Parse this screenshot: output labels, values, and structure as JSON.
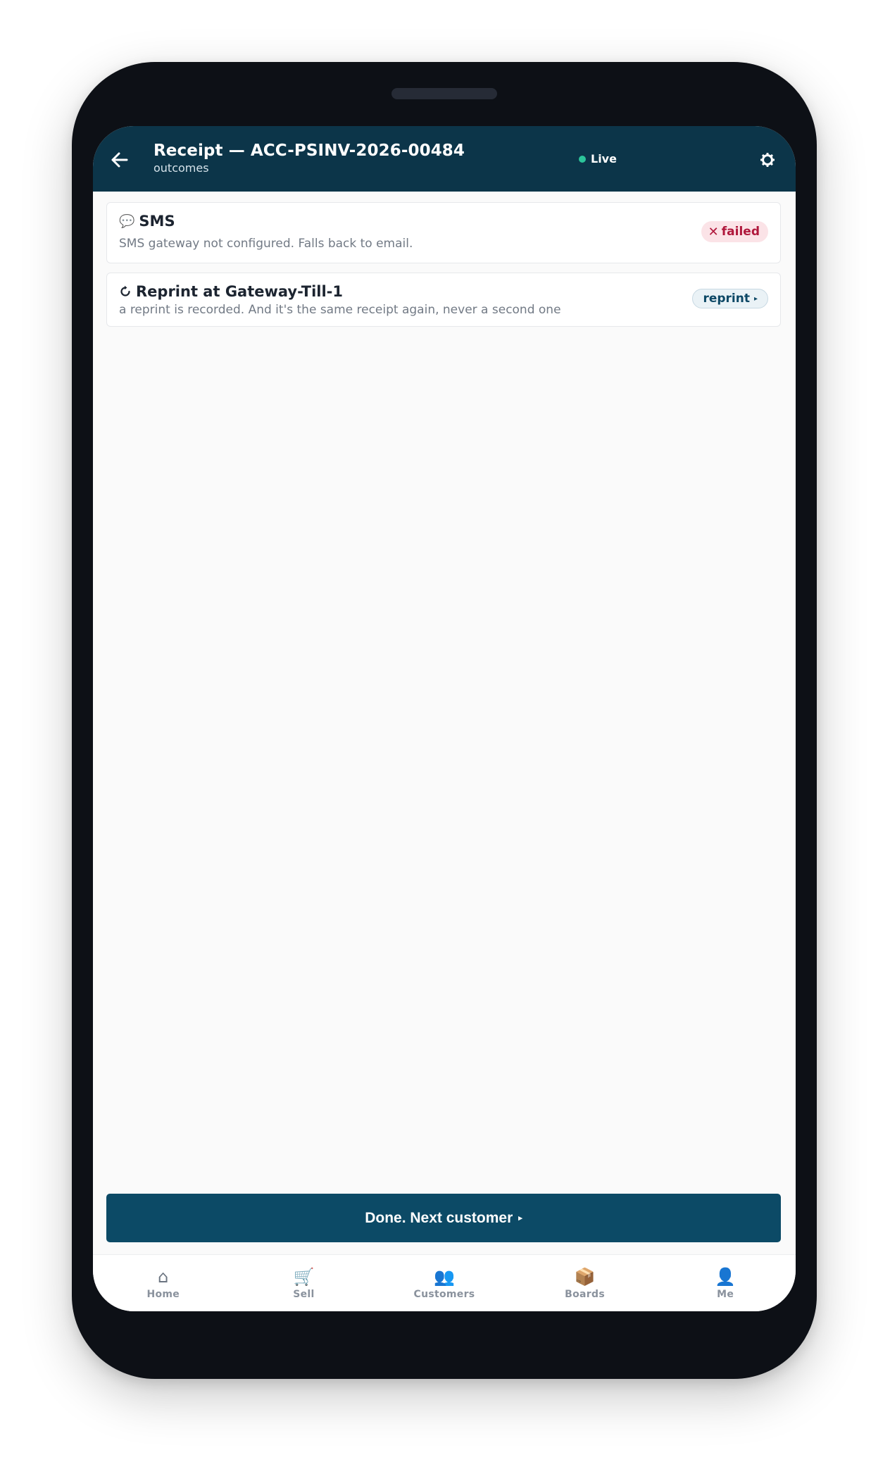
{
  "header": {
    "title": "Receipt — ACC-PSINV-2026-00484",
    "subtitle": "outcomes",
    "status": "Live"
  },
  "outcomes": [
    {
      "title": "SMS",
      "icon": "speech-bubble-icon",
      "description": "SMS gateway not configured. Falls back to email.",
      "badge": "failed"
    },
    {
      "title": "Reprint at Gateway-Till-1",
      "icon": "refresh-icon",
      "description": "a reprint is recorded. And it's the same receipt again, never a second one",
      "badge": "reprint"
    }
  ],
  "primary_action": "Done. Next customer",
  "nav": [
    {
      "label": "Home",
      "icon": "home-icon"
    },
    {
      "label": "Sell",
      "icon": "cart-icon"
    },
    {
      "label": "Customers",
      "icon": "people-icon"
    },
    {
      "label": "Boards",
      "icon": "package-icon"
    },
    {
      "label": "Me",
      "icon": "person-icon"
    }
  ],
  "colors": {
    "header_bg": "#0c3549",
    "primary_button": "#0c4a66",
    "live_dot": "#2cc59a",
    "failed_text": "#b0183c",
    "failed_bg": "#fbe3e7"
  }
}
